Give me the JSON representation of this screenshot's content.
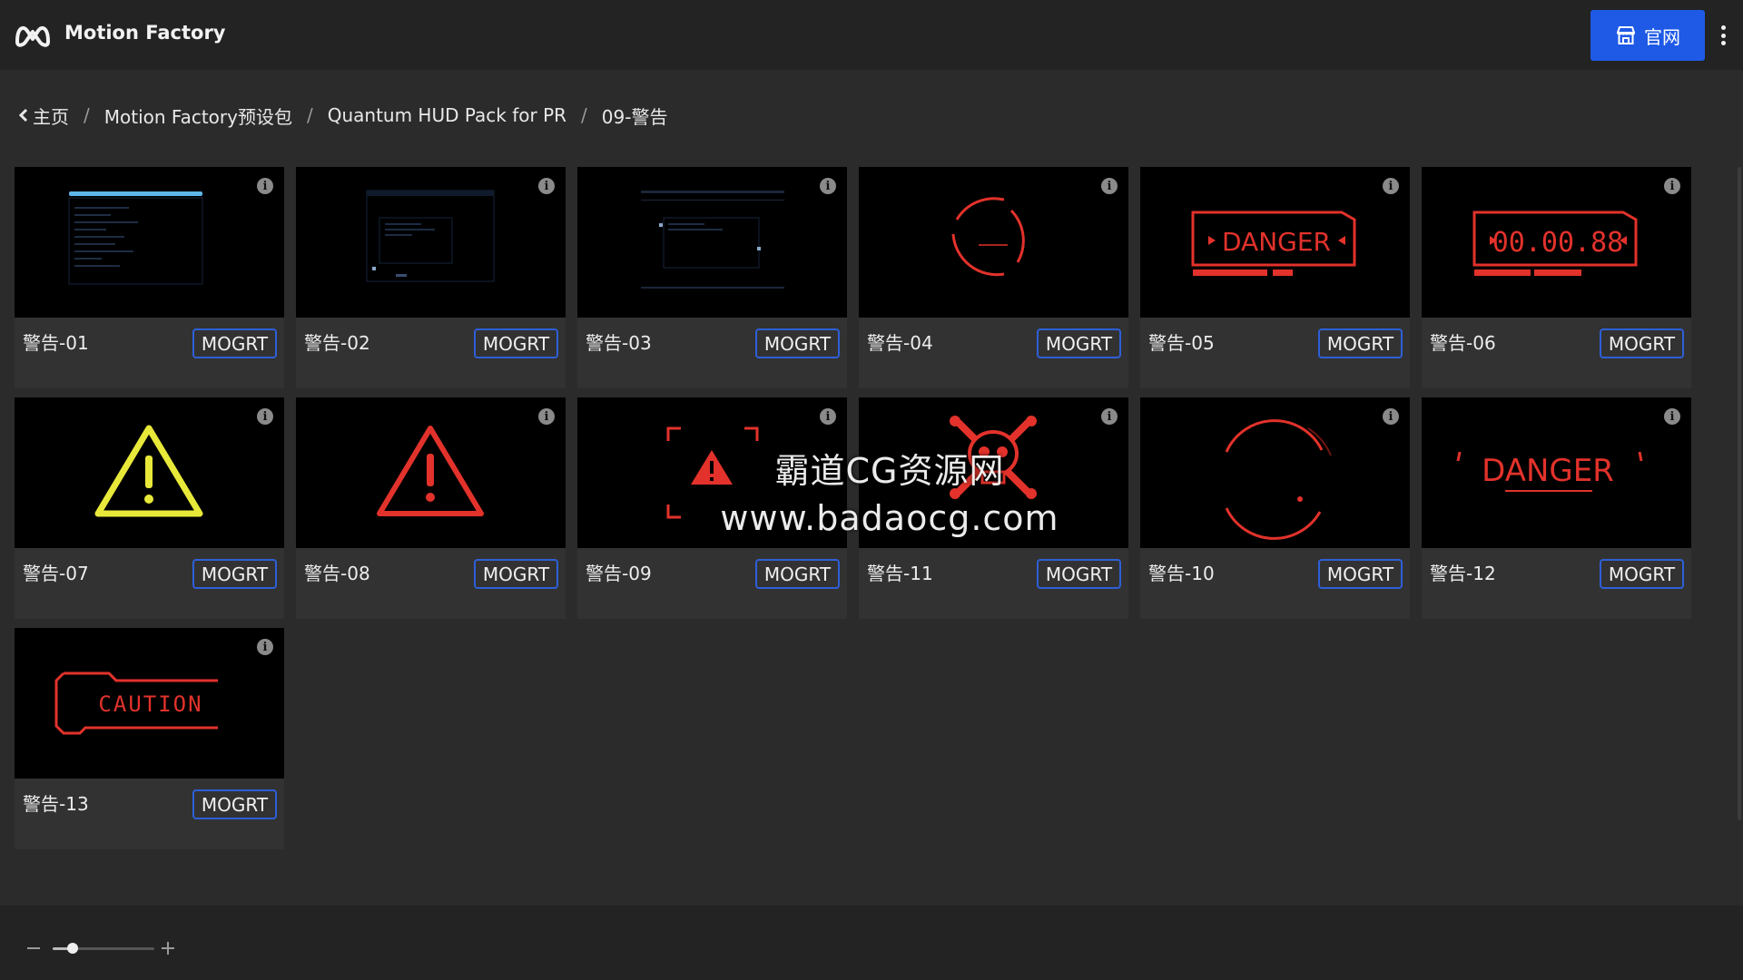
{
  "header": {
    "app_title": "Motion Factory",
    "site_button_label": "官网",
    "accent_color": "#1f5ae6"
  },
  "breadcrumb": {
    "home": "主页",
    "items": [
      "Motion Factory预设包",
      "Quantum HUD Pack for PR",
      "09-警告"
    ],
    "separator": "/"
  },
  "cards": [
    {
      "name": "警告-01",
      "badge": "MOGRT",
      "preview": "hud-terminal-blue"
    },
    {
      "name": "警告-02",
      "badge": "MOGRT",
      "preview": "hud-window-blue"
    },
    {
      "name": "警告-03",
      "badge": "MOGRT",
      "preview": "hud-panel-blue"
    },
    {
      "name": "警告-04",
      "badge": "MOGRT",
      "preview": "red-ring"
    },
    {
      "name": "警告-05",
      "badge": "MOGRT",
      "preview": "danger-frame",
      "text": "DANGER"
    },
    {
      "name": "警告-06",
      "badge": "MOGRT",
      "preview": "timer-frame",
      "text": "00.00.88"
    },
    {
      "name": "警告-07",
      "badge": "MOGRT",
      "preview": "yellow-warning-triangle"
    },
    {
      "name": "警告-08",
      "badge": "MOGRT",
      "preview": "red-warning-triangle"
    },
    {
      "name": "警告-09",
      "badge": "MOGRT",
      "preview": "red-warning-bracket"
    },
    {
      "name": "警告-11",
      "badge": "MOGRT",
      "preview": "skull-crossbones"
    },
    {
      "name": "警告-10",
      "badge": "MOGRT",
      "preview": "red-arc-ring"
    },
    {
      "name": "警告-12",
      "badge": "MOGRT",
      "preview": "danger-text",
      "text": "DANGER"
    },
    {
      "name": "警告-13",
      "badge": "MOGRT",
      "preview": "caution-frame",
      "text": "CAUTION"
    }
  ],
  "watermark": {
    "line1": "霸道CG资源网",
    "line2": "www.badaocg.com"
  },
  "zoom": {
    "level": 0.2
  },
  "icons": {
    "logo": "motion-factory-logo",
    "site": "storefront-icon",
    "more": "more-vertical-icon",
    "back": "chevron-left-icon",
    "info": "info-icon"
  }
}
